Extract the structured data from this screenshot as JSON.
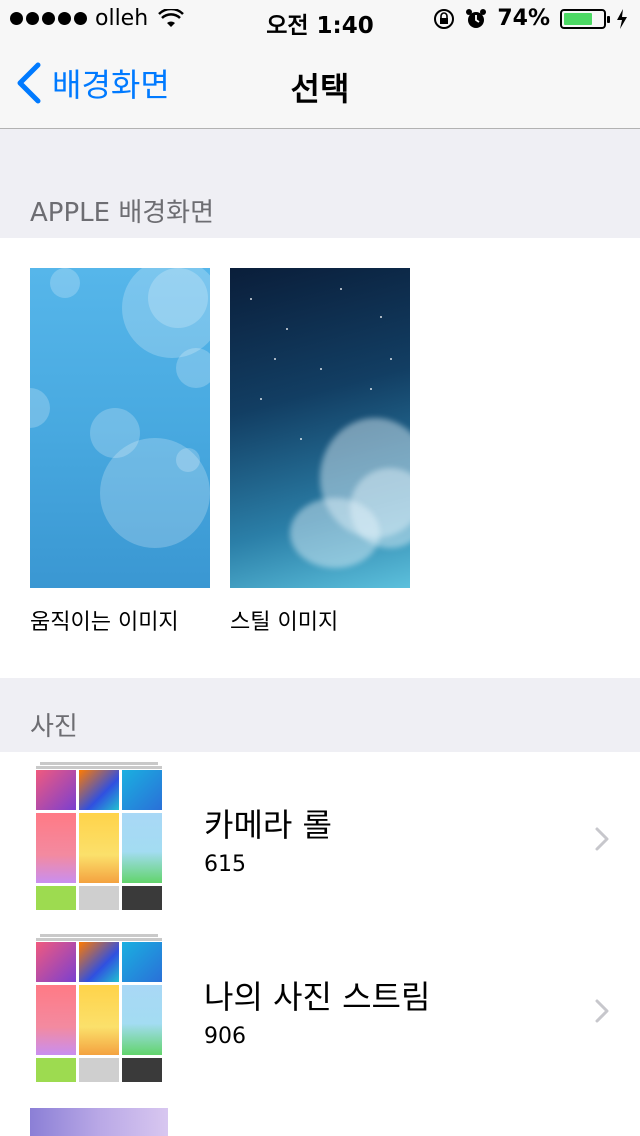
{
  "status_bar": {
    "carrier": "olleh",
    "time": "오전 1:40",
    "battery_percent": "74%",
    "battery_level": 0.74
  },
  "nav": {
    "back_label": "배경화면",
    "title": "선택"
  },
  "apple_section": {
    "header": "APPLE 배경화면",
    "items": [
      {
        "label": "움직이는 이미지"
      },
      {
        "label": "스틸 이미지"
      }
    ]
  },
  "photos_section": {
    "header": "사진",
    "albums": [
      {
        "title": "카메라 롤",
        "count": "615"
      },
      {
        "title": "나의 사진 스트림",
        "count": "906"
      }
    ]
  },
  "colors": {
    "accent": "#007aff",
    "battery_fill": "#4cd964",
    "section_bg": "#efeff4"
  }
}
